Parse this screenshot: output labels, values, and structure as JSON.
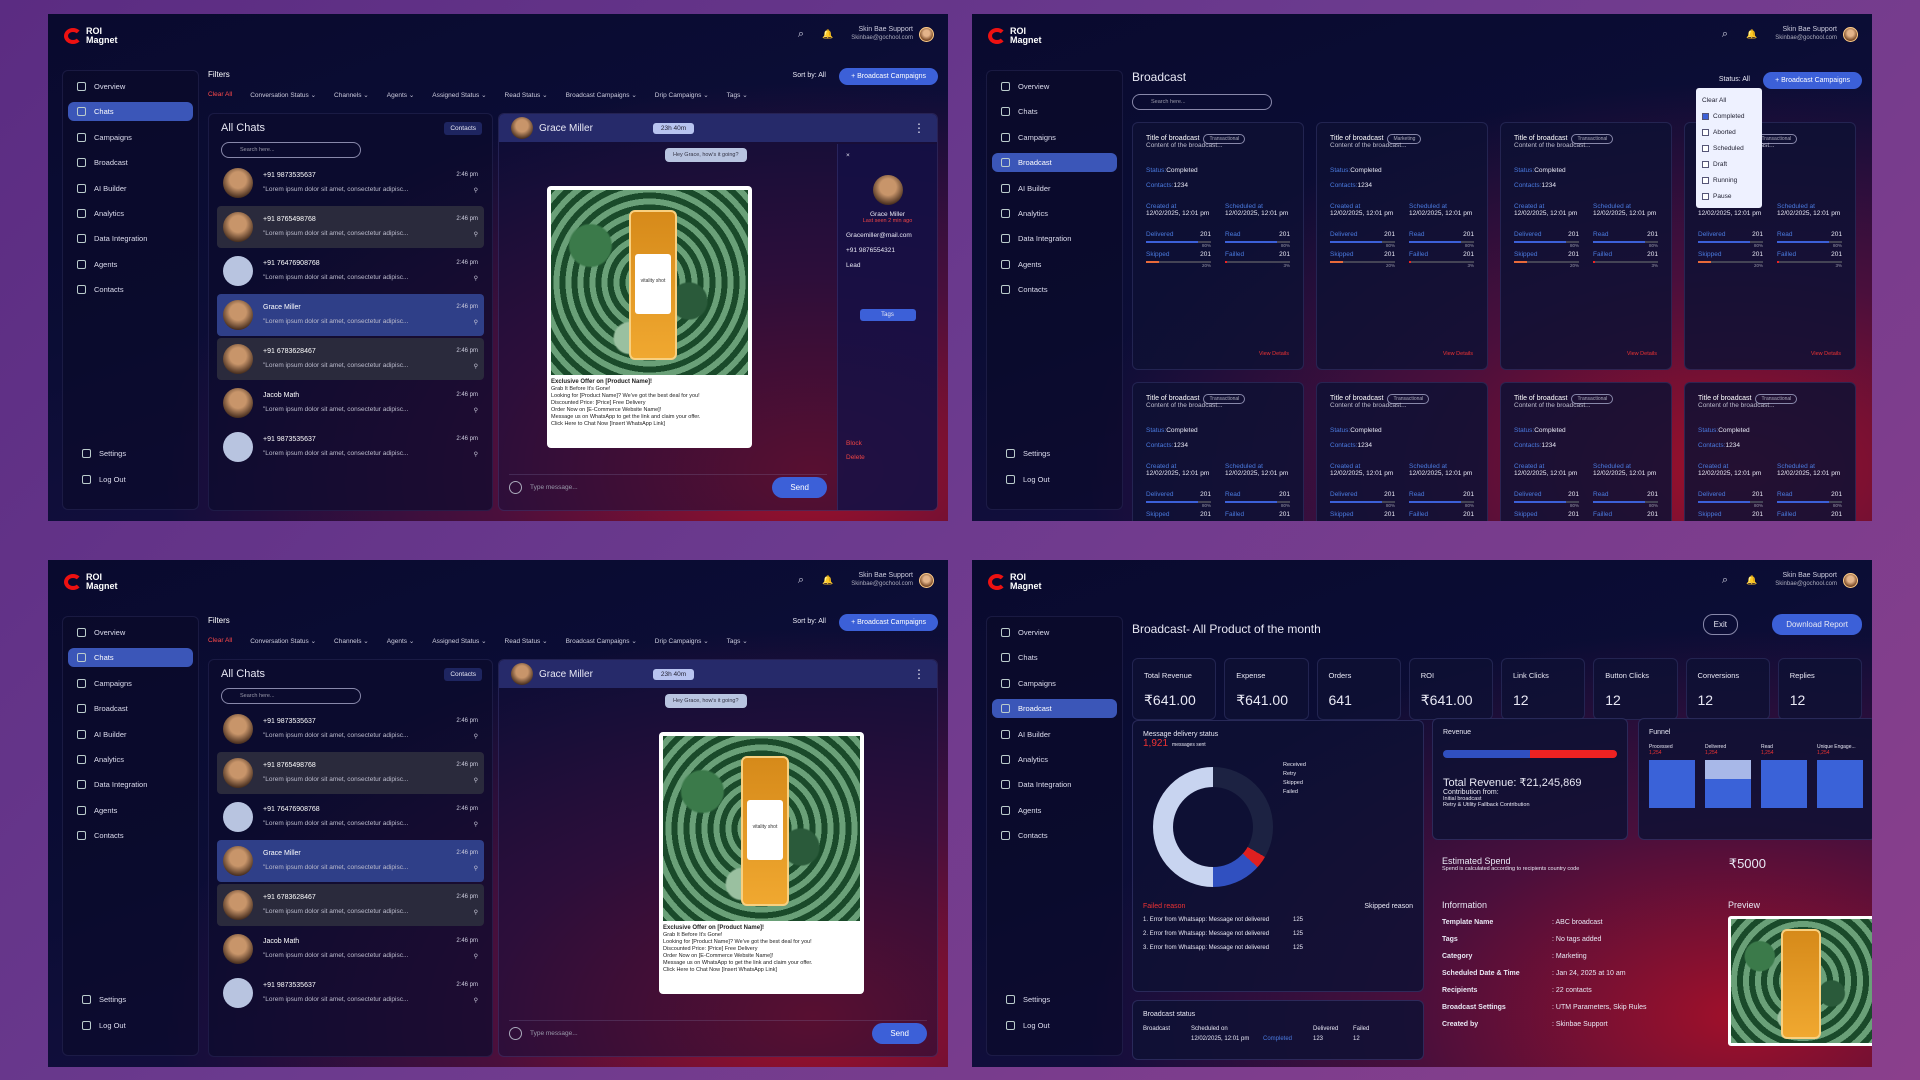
{
  "brand": {
    "l1": "ROI",
    "l2": "Magnet"
  },
  "user": {
    "name": "Skin Bae Support",
    "email": "Skinbae@gochool.com"
  },
  "nav": [
    "Overview",
    "Chats",
    "Campaigns",
    "Broadcast",
    "AI Builder",
    "Analytics",
    "Data Integration",
    "Agents",
    "Contacts"
  ],
  "nav_bottom": [
    "Settings",
    "Log Out"
  ],
  "filters": {
    "title": "Filters",
    "clear": "Clear All",
    "items": [
      "Conversation Status",
      "Channels",
      "Agents",
      "Assigned Status",
      "Read Status",
      "Broadcast Campaigns",
      "Drip Campaigns",
      "Tags"
    ],
    "sort": "Sort by: All",
    "cta": "+ Broadcast Campaigns"
  },
  "chats": {
    "title": "All Chats",
    "contacts_btn": "Contacts",
    "search": "Search here...",
    "preview": "\"Lorem ipsum dolor sit amet, consectetur adipisc...",
    "rows": [
      {
        "name": "+91 9873535637",
        "time": "2:46 pm",
        "style": "normal",
        "avatar": "photo"
      },
      {
        "name": "+91 8765498768",
        "time": "2:46 pm",
        "style": "dark",
        "avatar": "photo"
      },
      {
        "name": "+91 76476908768",
        "time": "2:46 pm",
        "style": "normal",
        "avatar": "blank"
      },
      {
        "name": "Grace Miller",
        "time": "2:46 pm",
        "style": "sel",
        "avatar": "photo"
      },
      {
        "name": "+91 6783628467",
        "time": "2:46 pm",
        "style": "dark",
        "avatar": "photo"
      },
      {
        "name": "Jacob Math",
        "time": "2:46 pm",
        "style": "normal",
        "avatar": "photo"
      },
      {
        "name": "+91 9873535637",
        "time": "2:46 pm",
        "style": "normal",
        "avatar": "blank"
      }
    ]
  },
  "conversation": {
    "name": "Grace Miller",
    "timer": "23h 40m",
    "incoming": "Hey Grace, how's it going?",
    "agent": "Norah Mathews",
    "time": "10:30 AM",
    "jar_label": "vitality shot",
    "offer_title": "Exclusive Offer on [Product Name]!",
    "offer_lines": [
      "Grab It Before It's Gone!",
      "Looking for [Product Name]? We've got the best deal for you!",
      "Discounted Price: [Price] Free Delivery",
      "Order Now on [E-Commerce Website Name]!",
      "Message us on WhatsApp to get the link and claim your offer.",
      "Click Here to Chat Now [Insert WhatsApp Link]"
    ],
    "placeholder": "Type message...",
    "send": "Send"
  },
  "contact_info": {
    "name": "Grace Miller",
    "last_seen": "Last seen 2 min ago",
    "email": "Gracemiller@mail.com",
    "phone": "+91 9876554321",
    "stage": "Lead",
    "tags": "Tags",
    "block": "Block",
    "delete": "Delete"
  },
  "broadcast": {
    "title": "Broadcast",
    "search": "Search here...",
    "status_label": "Status: All",
    "cta": "+ Broadcast Campaigns",
    "status_options": [
      "Clear All",
      "Completed",
      "Aborted",
      "Scheduled",
      "Draft",
      "Running",
      "Pause"
    ],
    "cards": [
      {
        "title": "Title of broadcast",
        "tag": "Transactional"
      },
      {
        "title": "Title of broadcast",
        "tag": "Marketing"
      },
      {
        "title": "Title of broadcast",
        "tag": "Transactional"
      },
      {
        "title": "Title of broadcast",
        "tag": "Transactional"
      },
      {
        "title": "Title of broadcast",
        "tag": "Transactional"
      },
      {
        "title": "Title of broadcast",
        "tag": "Transactional"
      },
      {
        "title": "Title of broadcast",
        "tag": "Transactional"
      },
      {
        "title": "Title of broadcast",
        "tag": "Transactional"
      }
    ],
    "content": "Content of the broadcast...",
    "status_k": "Status:",
    "status_v": "Completed",
    "contacts_k": "Contacts:",
    "contacts_v": "1234",
    "created_k": "Created at",
    "created_v": "12/02/2025, 12:01 pm",
    "sched_k": "Scheduled at",
    "sched_v": "12/02/2025, 12:01 pm",
    "stats": [
      {
        "k": "Delivered",
        "v": "201",
        "p": "80%",
        "f": 0.8
      },
      {
        "k": "Read",
        "v": "201",
        "p": "80%",
        "f": 0.8
      },
      {
        "k": "Skipped",
        "v": "201",
        "p": "20%",
        "f": 0.2
      },
      {
        "k": "Failled",
        "v": "201",
        "p": "3%",
        "f": 0.03
      }
    ],
    "view": "View Details"
  },
  "report": {
    "title": "Broadcast- All Product of the month",
    "exit": "Exit",
    "download": "Download Report",
    "kpis": [
      {
        "k": "Total Revenue",
        "v": "₹641.00"
      },
      {
        "k": "Expense",
        "v": "₹641.00"
      },
      {
        "k": "Orders",
        "v": "641"
      },
      {
        "k": "ROI",
        "v": "₹641.00"
      },
      {
        "k": "Link Clicks",
        "v": "12"
      },
      {
        "k": "Button Clicks",
        "v": "12"
      },
      {
        "k": "Conversions",
        "v": "12"
      },
      {
        "k": "Replies",
        "v": "12"
      }
    ],
    "delivery": {
      "title": "Message delivery status",
      "count": "1,921",
      "sub": "messages sent",
      "legend": [
        "Received",
        "Retry",
        "Skipped",
        "Failed"
      ],
      "failed_reason": "Failed reason",
      "skipped_reason": "Skipped reason",
      "reasons": [
        {
          "t": "1. Error from Whatsapp: Message not delivered",
          "v": "125"
        },
        {
          "t": "2. Error from Whatsapp: Message not delivered",
          "v": "125"
        },
        {
          "t": "3. Error from Whatsapp: Message not delivered",
          "v": "125"
        }
      ]
    },
    "revenue": {
      "title": "Revenue",
      "total": "Total Revenue: ₹21,245,869",
      "contrib": "Contribution from:",
      "items": [
        "Initial broadcast",
        "Retry & Utility Fallback Contribution"
      ]
    },
    "funnel": {
      "title": "Funnel",
      "cols": [
        {
          "k": "Processed",
          "v": "1,254"
        },
        {
          "k": "Delivered",
          "v": "1,254"
        },
        {
          "k": "Read",
          "v": "1,254"
        },
        {
          "k": "Unique Engage...",
          "v": "1,254"
        }
      ]
    },
    "spend": {
      "title": "Estimated Spend",
      "note": "Spend is calculated according to recipients country code",
      "value": "₹5000"
    },
    "information": {
      "title": "Information",
      "rows": [
        [
          "Template Name",
          ": ABC broadcast"
        ],
        [
          "Tags",
          ": No tags added"
        ],
        [
          "Category",
          ": Marketing"
        ],
        [
          "Scheduled Date & Time",
          ": Jan 24, 2025 at 10 am"
        ],
        [
          "Recipients",
          ": 22 contacts"
        ],
        [
          "Broadcast Settings",
          ": UTM Parameters, Skip Rules"
        ],
        [
          "Created by",
          ": Skinbae Support"
        ]
      ]
    },
    "preview": "Preview",
    "bstatus": {
      "title": "Broadcast status",
      "cols": [
        "Broadcast",
        "Scheduled on",
        "",
        "Delivered",
        "Failed"
      ],
      "row": [
        "",
        "12/02/2025, 12:01 pm",
        "Completed",
        "123",
        "12"
      ]
    }
  }
}
